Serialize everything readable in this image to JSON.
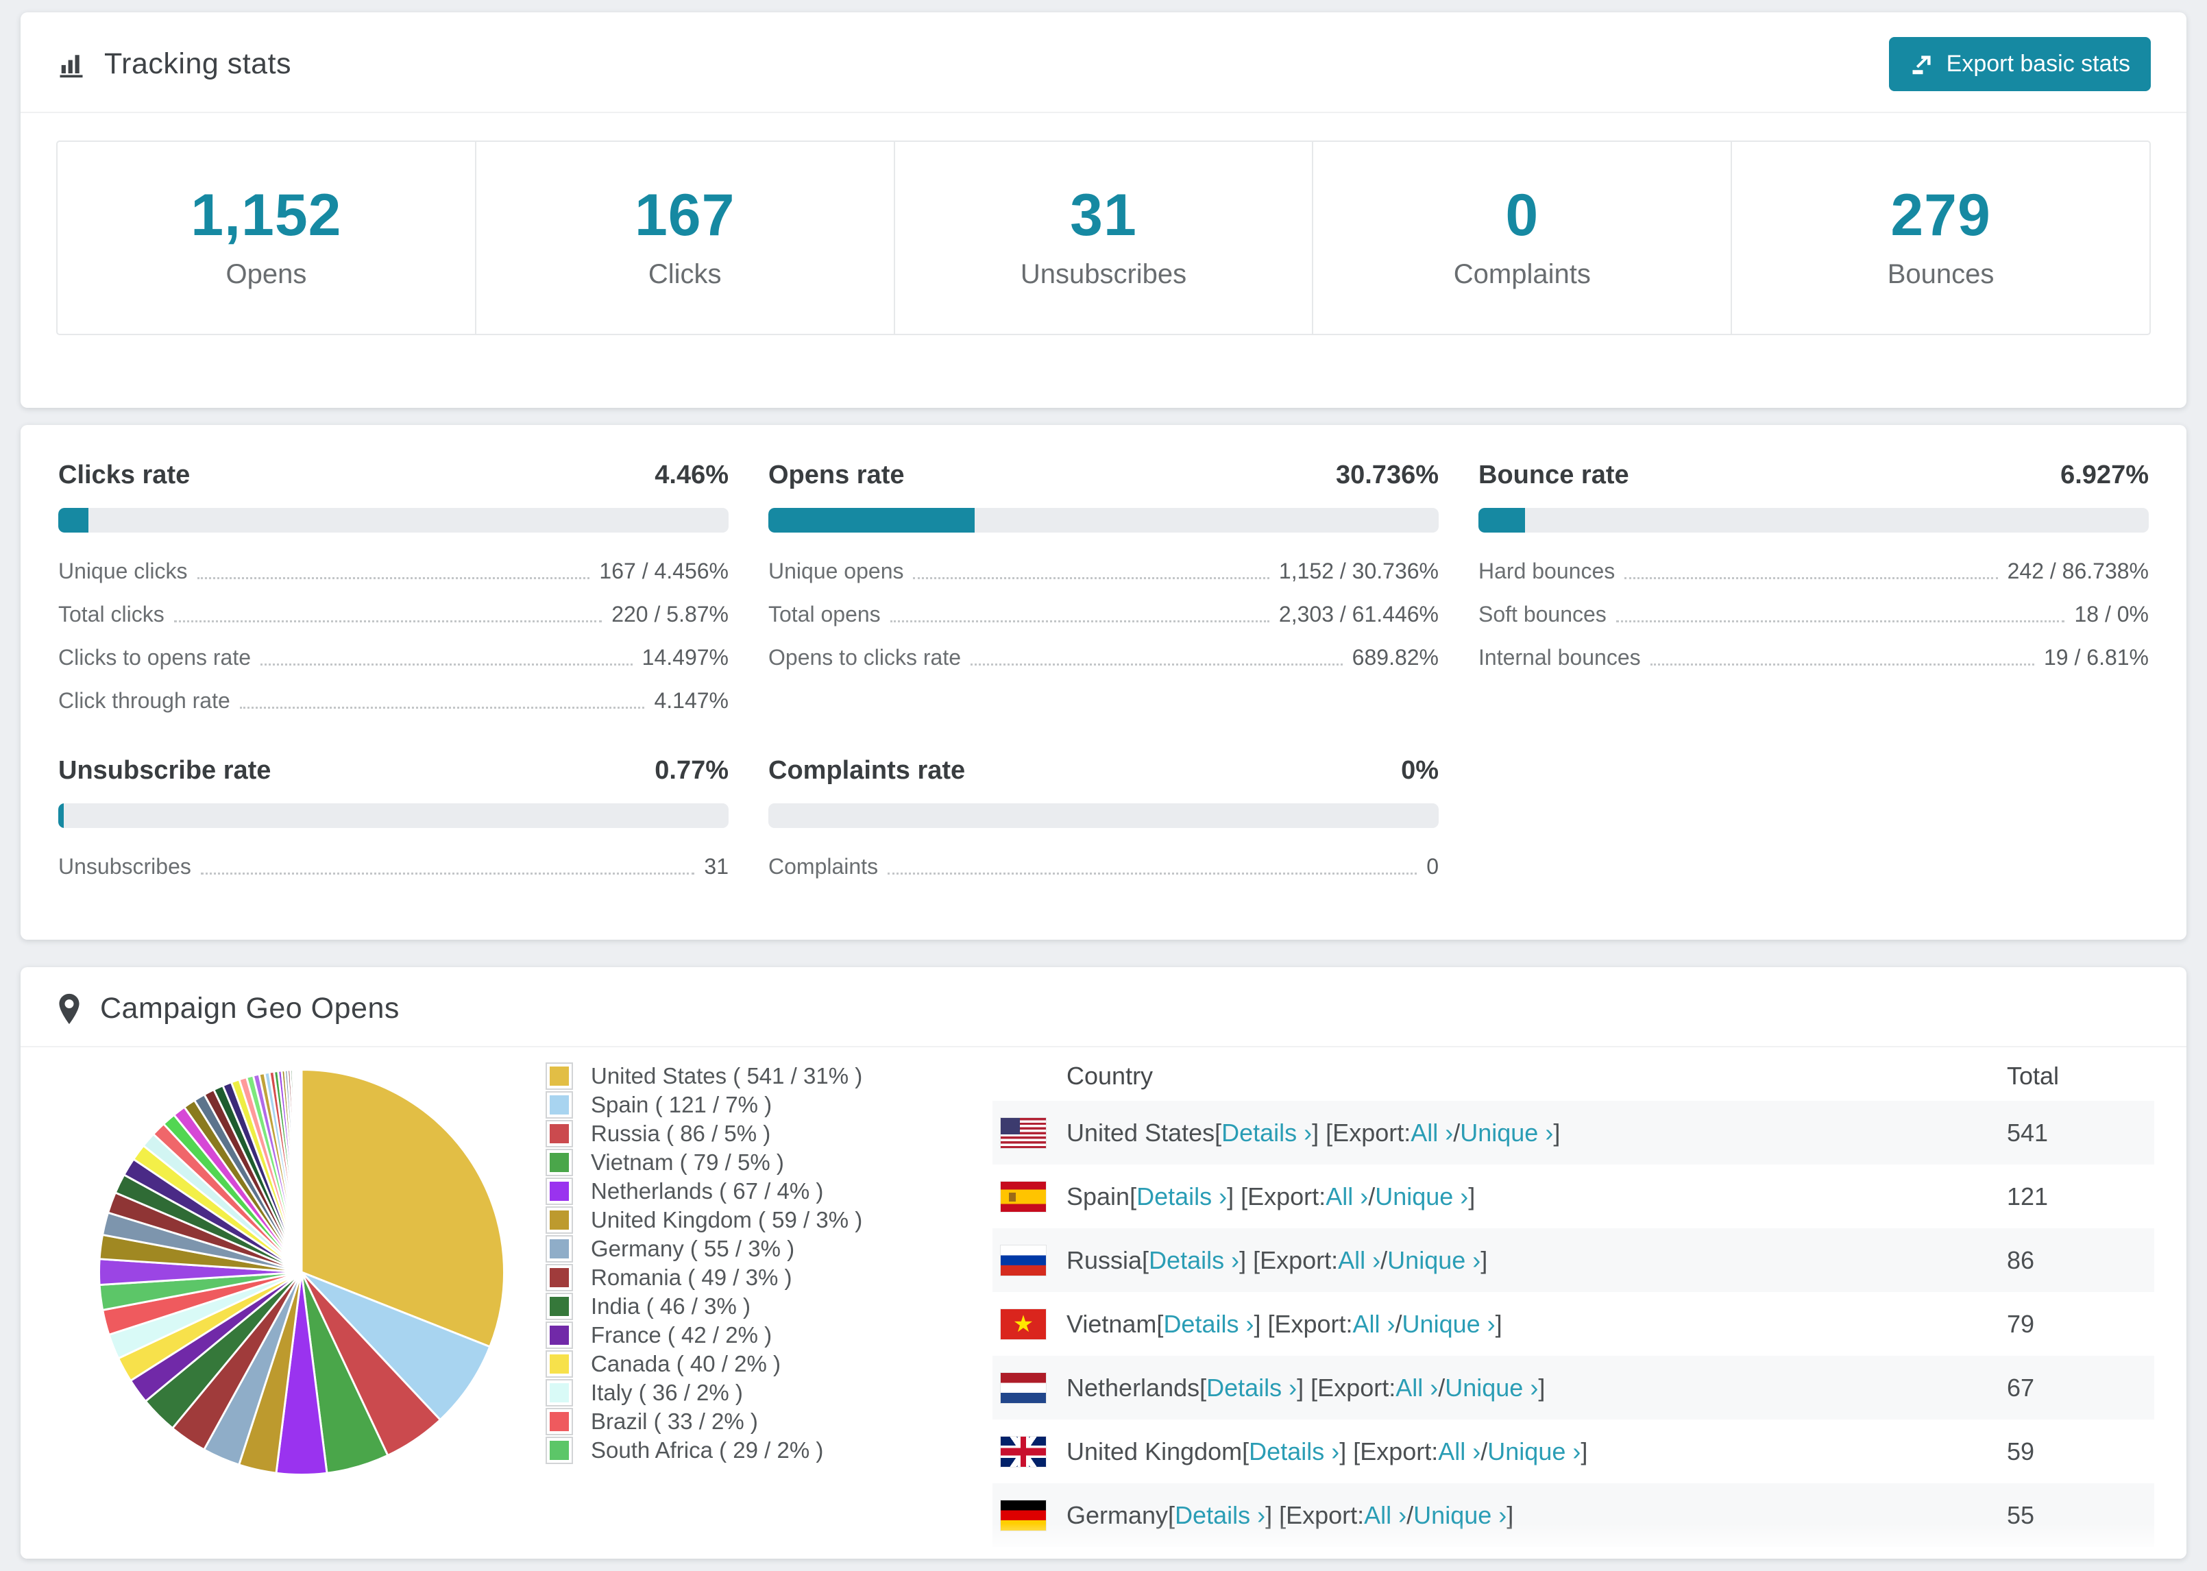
{
  "colors": {
    "accent": "#1689a2",
    "link": "#2a9db5",
    "page_bg": "#edeff2"
  },
  "tracking": {
    "title": "Tracking stats",
    "export_button": "Export basic stats",
    "stats": [
      {
        "value": "1,152",
        "label": "Opens"
      },
      {
        "value": "167",
        "label": "Clicks"
      },
      {
        "value": "31",
        "label": "Unsubscribes"
      },
      {
        "value": "0",
        "label": "Complaints"
      },
      {
        "value": "279",
        "label": "Bounces"
      }
    ]
  },
  "rates": {
    "panels": [
      {
        "title": "Clicks rate",
        "value": "4.46%",
        "percent": 4.46,
        "rows": [
          {
            "label": "Unique clicks",
            "value": "167 / 4.456%"
          },
          {
            "label": "Total clicks",
            "value": "220 / 5.87%"
          },
          {
            "label": "Clicks to opens rate",
            "value": "14.497%"
          },
          {
            "label": "Click through rate",
            "value": "4.147%"
          }
        ]
      },
      {
        "title": "Opens rate",
        "value": "30.736%",
        "percent": 30.736,
        "rows": [
          {
            "label": "Unique opens",
            "value": "1,152 / 30.736%"
          },
          {
            "label": "Total opens",
            "value": "2,303 / 61.446%"
          },
          {
            "label": "Opens to clicks rate",
            "value": "689.82%"
          }
        ]
      },
      {
        "title": "Bounce rate",
        "value": "6.927%",
        "percent": 6.927,
        "rows": [
          {
            "label": "Hard bounces",
            "value": "242 / 86.738%"
          },
          {
            "label": "Soft bounces",
            "value": "18 / 0%"
          },
          {
            "label": "Internal bounces",
            "value": "19 / 6.81%"
          }
        ]
      },
      {
        "title": "Unsubscribe rate",
        "value": "0.77%",
        "percent": 0.77,
        "rows": [
          {
            "label": "Unsubscribes",
            "value": "31"
          }
        ]
      },
      {
        "title": "Complaints rate",
        "value": "0%",
        "percent": 0,
        "rows": [
          {
            "label": "Complaints",
            "value": "0"
          }
        ]
      }
    ]
  },
  "geo": {
    "title": "Campaign Geo Opens",
    "table": {
      "headers": [
        "Country",
        "Total"
      ],
      "labels": {
        "details": "Details ›",
        "all": "All ›",
        "unique": "Unique ›",
        "open": " [",
        "export_open": "] [Export: ",
        "slash": " / ",
        "close": "]"
      },
      "rows": [
        {
          "flag": "us",
          "country": "United States",
          "total": "541"
        },
        {
          "flag": "es",
          "country": "Spain",
          "total": "121"
        },
        {
          "flag": "ru",
          "country": "Russia",
          "total": "86"
        },
        {
          "flag": "vn",
          "country": "Vietnam",
          "total": "79"
        },
        {
          "flag": "nl",
          "country": "Netherlands",
          "total": "67"
        },
        {
          "flag": "gb",
          "country": "United Kingdom",
          "total": "59"
        },
        {
          "flag": "de",
          "country": "Germany",
          "total": "55"
        }
      ]
    }
  },
  "chart_data": {
    "type": "pie",
    "title": "Campaign Geo Opens",
    "legend_position": "right-of-pie",
    "label_format": "{label} ( {value} / {percent}% )",
    "slices": [
      {
        "label": "United States",
        "value": 541,
        "percent": 31,
        "color": "#e2be45"
      },
      {
        "label": "Spain",
        "value": 121,
        "percent": 7,
        "color": "#a8d4f0"
      },
      {
        "label": "Russia",
        "value": 86,
        "percent": 5,
        "color": "#cb4a4e"
      },
      {
        "label": "Vietnam",
        "value": 79,
        "percent": 5,
        "color": "#4aa64a"
      },
      {
        "label": "Netherlands",
        "value": 67,
        "percent": 4,
        "color": "#9a33ef"
      },
      {
        "label": "United Kingdom",
        "value": 59,
        "percent": 3,
        "color": "#bd9a2e"
      },
      {
        "label": "Germany",
        "value": 55,
        "percent": 3,
        "color": "#8fadc8"
      },
      {
        "label": "Romania",
        "value": 49,
        "percent": 3,
        "color": "#a03b3b"
      },
      {
        "label": "India",
        "value": 46,
        "percent": 3,
        "color": "#35783a"
      },
      {
        "label": "France",
        "value": 42,
        "percent": 2,
        "color": "#7129a8"
      },
      {
        "label": "Canada",
        "value": 40,
        "percent": 2,
        "color": "#f7e14b"
      },
      {
        "label": "Italy",
        "value": 36,
        "percent": 2,
        "color": "#d9faf7"
      },
      {
        "label": "Brazil",
        "value": 33,
        "percent": 2,
        "color": "#ef5a5e"
      },
      {
        "label": "South Africa",
        "value": 29,
        "percent": 2,
        "color": "#5cc668"
      }
    ],
    "unlabeled_slices": {
      "note": "remaining small countries shown as thin unlabeled slivers",
      "weights": [
        1.7,
        1.6,
        1.5,
        1.4,
        1.3,
        1.2,
        1.1,
        1.0,
        0.95,
        0.9,
        0.85,
        0.8,
        0.75,
        0.7,
        0.65,
        0.6,
        0.55,
        0.5,
        0.45,
        0.4,
        0.36,
        0.33,
        0.3,
        0.27,
        0.24,
        0.21,
        0.19,
        0.17,
        0.15,
        0.13,
        0.11,
        0.09,
        0.08,
        0.07,
        0.06,
        0.05
      ]
    },
    "palette_small": [
      "#9b45e4",
      "#a08822",
      "#7d95ad",
      "#8f3535",
      "#2f6b35",
      "#4a2a86",
      "#f3ef48",
      "#d2f5f3",
      "#f0666a",
      "#52d652",
      "#d648d6",
      "#8a7a1e",
      "#5c748c",
      "#7c2d2d",
      "#1e5c2e",
      "#3b2a78",
      "#eeee44",
      "#ff9a9a",
      "#7ce87c",
      "#b06ae8",
      "#c0a23a",
      "#a8d4f0",
      "#d44c4c",
      "#44a644"
    ]
  }
}
